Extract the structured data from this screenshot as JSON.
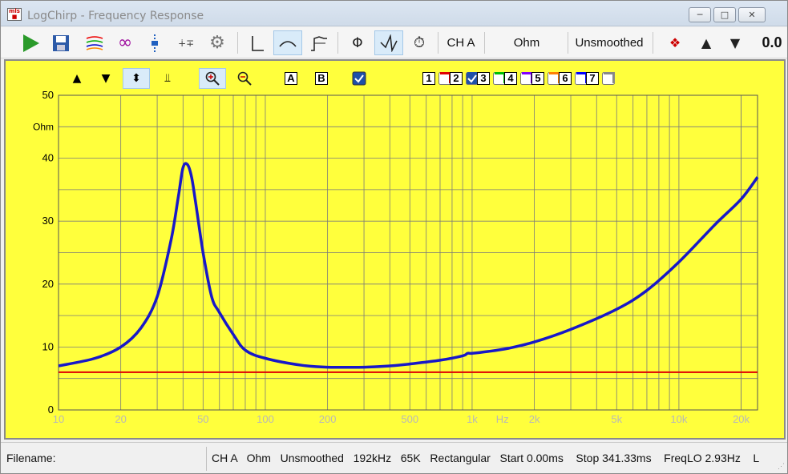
{
  "window": {
    "title": "LogChirp - Frequency Response"
  },
  "toolbar": {
    "icons": [
      "run-icon",
      "save-icon",
      "multi-curve-icon",
      "loop-icon",
      "marker-icon",
      "step-icon",
      "settings-icon",
      "impulse-icon",
      "frequency-icon",
      "step-response-icon",
      "phase-icon",
      "magnitude-icon",
      "clock-icon",
      "peak-icon",
      "up-arrow-icon",
      "down-arrow-icon"
    ],
    "channel": "CH A",
    "unit": "Ohm",
    "smoothing": "Unsmoothed",
    "value": "0.0"
  },
  "plotbar": {
    "box_a": "A",
    "box_b": "B",
    "overlays": [
      {
        "label": "1",
        "color": "#e00000",
        "checked": false
      },
      {
        "label": "2",
        "color": "#1f4fa8",
        "checked": true
      },
      {
        "label": "3",
        "color": "#00c000",
        "checked": false
      },
      {
        "label": "4",
        "color": "#8000ff",
        "checked": false
      },
      {
        "label": "5",
        "color": "#ff8000",
        "checked": false
      },
      {
        "label": "6",
        "color": "#0000ff",
        "checked": false
      },
      {
        "label": "7",
        "color": "#888888",
        "checked": false
      }
    ]
  },
  "colors": {
    "plot_bg": "#ffff3c",
    "curve": "#1818c8",
    "reference": "#e00000",
    "grid": "#7a7a7a"
  },
  "chart_data": {
    "type": "line",
    "xscale": "log",
    "xlim": [
      10,
      24000
    ],
    "ylim": [
      0,
      50
    ],
    "ylabel": "Ohm",
    "xunit": "Hz",
    "yticks": [
      0,
      10,
      20,
      30,
      40,
      50
    ],
    "xtick_labels": [
      {
        "x": 10,
        "label": "10"
      },
      {
        "x": 20,
        "label": "20"
      },
      {
        "x": 50,
        "label": "50"
      },
      {
        "x": 100,
        "label": "100"
      },
      {
        "x": 200,
        "label": "200"
      },
      {
        "x": 500,
        "label": "500"
      },
      {
        "x": 1000,
        "label": "1k"
      },
      {
        "x": 2000,
        "label": "2k"
      },
      {
        "x": 5000,
        "label": "5k"
      },
      {
        "x": 10000,
        "label": "10k"
      },
      {
        "x": 20000,
        "label": "20k"
      }
    ],
    "series": [
      {
        "x": [
          10,
          15,
          20,
          25,
          30,
          35,
          38,
          40,
          42,
          44,
          46,
          50,
          55,
          60,
          70,
          80,
          100,
          150,
          200,
          300,
          400,
          500,
          700,
          900,
          950,
          1000,
          1200,
          1500,
          2000,
          3000,
          5000,
          7000,
          10000,
          15000,
          20000,
          24000
        ],
        "y": [
          7.0,
          8.2,
          10.0,
          13.0,
          18.0,
          27.0,
          34.0,
          38.5,
          39.0,
          37.0,
          33.0,
          25.0,
          18.0,
          15.5,
          12.0,
          9.5,
          8.2,
          7.1,
          6.8,
          6.8,
          7.0,
          7.3,
          7.9,
          8.6,
          9.0,
          9.0,
          9.3,
          9.8,
          10.8,
          12.8,
          16.0,
          19.0,
          23.5,
          29.5,
          33.5,
          37.0
        ]
      },
      {
        "name": "",
        "x": [
          10,
          24000
        ],
        "y": [
          6.0,
          6.0
        ]
      }
    ]
  },
  "status": {
    "filename_label": "Filename:",
    "info": "CH A   Ohm   Unsmoothed   192kHz   65K   Rectangular   Start 0.00ms    Stop 341.33ms    FreqLO 2.93Hz    L"
  }
}
